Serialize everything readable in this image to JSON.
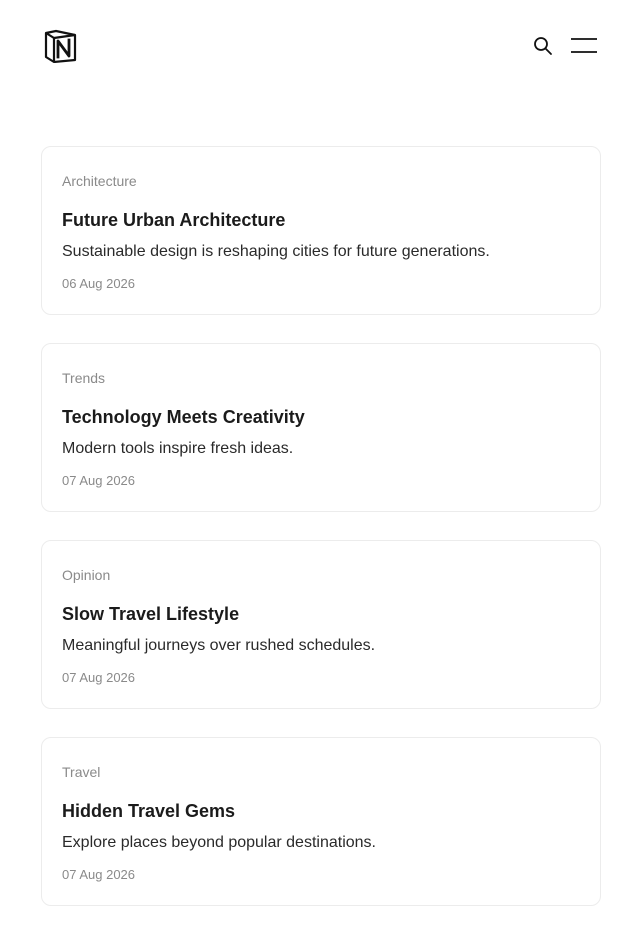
{
  "header": {
    "logo_icon": "notion-logo-icon",
    "search_icon": "search-icon",
    "menu_icon": "hamburger-menu-icon"
  },
  "posts": [
    {
      "category": "Architecture",
      "title": "Future Urban Architecture",
      "excerpt": "Sustainable design is reshaping cities for future generations.",
      "date": "06 Aug 2026"
    },
    {
      "category": "Trends",
      "title": "Technology Meets Creativity",
      "excerpt": "Modern tools inspire fresh ideas.",
      "date": "07 Aug 2026"
    },
    {
      "category": "Opinion",
      "title": "Slow Travel Lifestyle",
      "excerpt": "Meaningful journeys over rushed schedules.",
      "date": "07 Aug 2026"
    },
    {
      "category": "Travel",
      "title": "Hidden Travel Gems",
      "excerpt": "Explore places beyond popular destinations.",
      "date": "07 Aug 2026"
    }
  ],
  "colors": {
    "text": "#1b1b1b",
    "muted": "#8a8a8a",
    "border": "#ececec",
    "background": "#ffffff"
  }
}
